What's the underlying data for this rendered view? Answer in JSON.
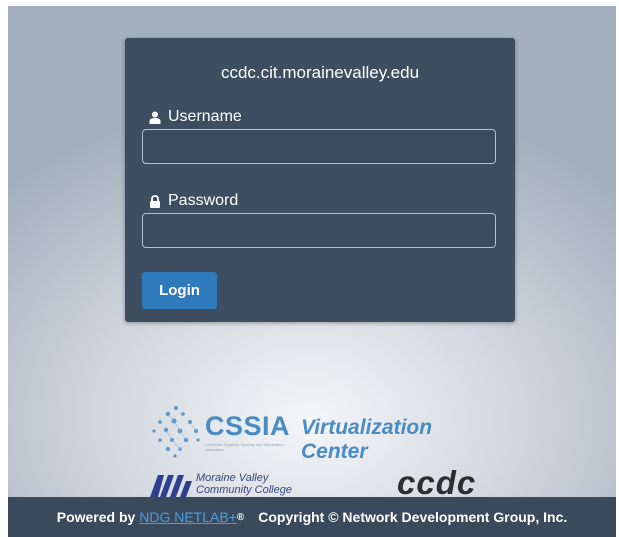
{
  "login": {
    "host": "ccdc.cit.morainevalley.edu",
    "username_label": "Username",
    "username_value": "",
    "password_label": "Password",
    "password_value": "",
    "login_button": "Login"
  },
  "logos": {
    "cssia": "CSSIA",
    "cssia_tagline": "Center for Systems Security and Information Assurance",
    "virtualization_center": "Virtualization Center",
    "moraine_valley_line1": "Moraine Valley",
    "moraine_valley_line2": "Community College",
    "ccdc": "ccdc"
  },
  "footer": {
    "powered_by": "Powered by ",
    "netlab_link": "NDG NETLAB+",
    "registered": "®",
    "copyright": "Copyright © Network Development Group, Inc."
  },
  "colors": {
    "card_background": "#3d4e61",
    "button_blue": "#2f79bd",
    "footer_background": "#3a4a5c",
    "link_blue": "#4a9ee0",
    "logo_blue": "#4a8bc4"
  },
  "icons": {
    "username": "user-icon",
    "password": "lock-icon"
  }
}
